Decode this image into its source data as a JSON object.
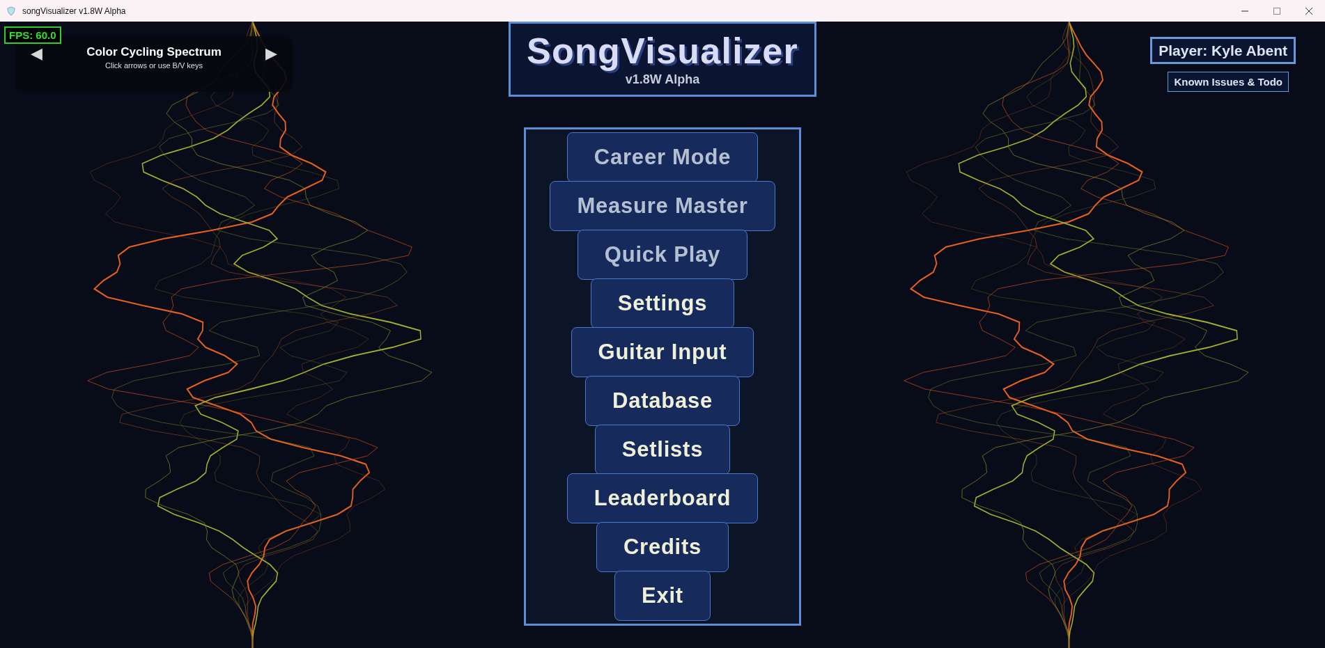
{
  "window": {
    "title": "songVisualizer v1.8W Alpha"
  },
  "fps": "FPS: 60.0",
  "visualizer_selector": {
    "prev": "◀",
    "name": "Color Cycling Spectrum",
    "hint": "Click arrows or use B/V keys",
    "next": "▶"
  },
  "header": {
    "title": "SongVisualizer",
    "version": "v1.8W Alpha"
  },
  "player": "Player: Kyle Abent",
  "known_issues_button": "Known Issues & Todo",
  "menu": [
    {
      "label": "Career Mode",
      "disabled": true
    },
    {
      "label": "Measure Master",
      "disabled": true
    },
    {
      "label": "Quick Play",
      "disabled": true
    },
    {
      "label": "Settings",
      "disabled": false
    },
    {
      "label": "Guitar Input",
      "disabled": false
    },
    {
      "label": "Database",
      "disabled": false
    },
    {
      "label": "Setlists",
      "disabled": false
    },
    {
      "label": "Leaderboard",
      "disabled": false
    },
    {
      "label": "Credits",
      "disabled": false
    },
    {
      "label": "Exit",
      "disabled": false
    }
  ]
}
